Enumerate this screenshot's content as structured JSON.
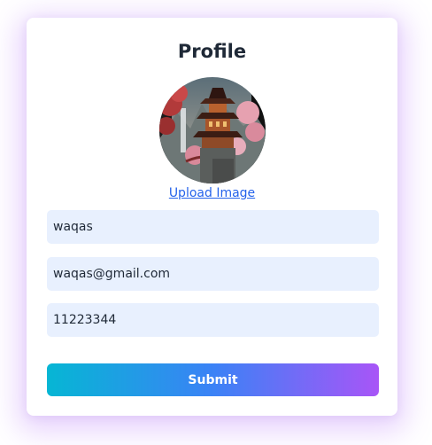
{
  "profile": {
    "title": "Profile",
    "avatar_icon": "pagoda-landscape-image",
    "upload_label": "Upload Image"
  },
  "form": {
    "name_value": "waqas",
    "email_value": "waqas@gmail.com",
    "phone_value": "11223344",
    "submit_label": "Submit"
  },
  "colors": {
    "gradient_start": "#06b6d4",
    "gradient_end": "#a855f7",
    "input_bg": "#e8f0fe",
    "link": "#2563eb"
  }
}
